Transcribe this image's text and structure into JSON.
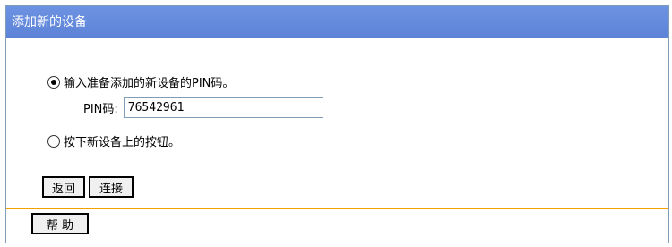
{
  "title": "添加新的设备",
  "options": [
    {
      "label": "输入准备添加的新设备的PIN码。",
      "selected": true
    },
    {
      "label": "按下新设备上的按钮。",
      "selected": false
    }
  ],
  "pin": {
    "label": "PIN码:",
    "value": "76542961"
  },
  "buttons": {
    "back": "返回",
    "connect": "连接",
    "help": "帮 助"
  }
}
